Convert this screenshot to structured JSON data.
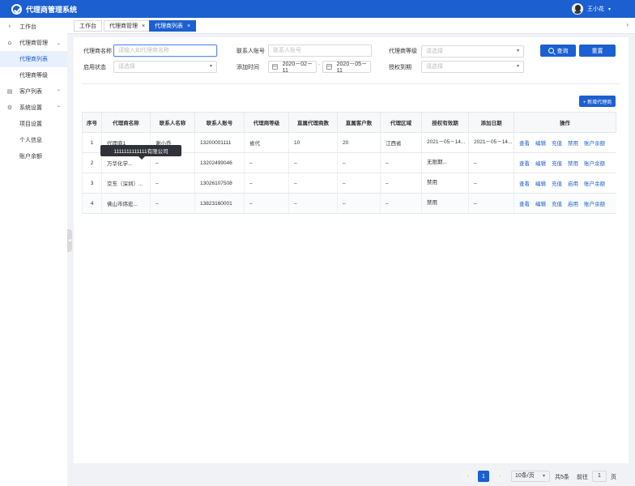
{
  "app": {
    "title": "代理商管理系统",
    "user": "王小花"
  },
  "sidebar": {
    "items": [
      {
        "label": "工作台",
        "icon": "dashboard-icon"
      },
      {
        "label": "代理商管理",
        "icon": "person-icon",
        "expanded": true,
        "children": [
          {
            "label": "代理商列表",
            "active": true
          },
          {
            "label": "代理商等级"
          }
        ]
      },
      {
        "label": "客户列表",
        "icon": "document-icon",
        "expanded": false
      },
      {
        "label": "系统设置",
        "icon": "gear-icon",
        "expanded": true,
        "children": [
          {
            "label": "项目设置"
          },
          {
            "label": "个人信息"
          },
          {
            "label": "账户余额"
          }
        ]
      }
    ]
  },
  "tabs": [
    {
      "label": "工作台",
      "closable": false
    },
    {
      "label": "代理商管理",
      "closable": true
    },
    {
      "label": "代理商列表",
      "closable": true,
      "active": true
    }
  ],
  "filters": {
    "agent_name": {
      "label": "代理商名称",
      "placeholder": "请输入如代理商名称"
    },
    "contact_account": {
      "label": "联系人账号",
      "placeholder": "联系人账号"
    },
    "agent_level": {
      "label": "代理商等级",
      "placeholder": "请选择"
    },
    "status": {
      "label": "启用状态",
      "placeholder": "请选择"
    },
    "add_time": {
      "label": "添加时间",
      "start": "2020－02－11",
      "end": "2020－05－11",
      "separator": "-"
    },
    "auth_expiry": {
      "label": "授权到期",
      "placeholder": "请选择"
    },
    "query_label": "查询",
    "reset_label": "重置"
  },
  "add_agent_label": "+ 新增代理商",
  "table": {
    "columns": [
      "序号",
      "代理商名称",
      "联系人名称",
      "联系人账号",
      "代理商等级",
      "直属代理商数",
      "直属客户数",
      "代理区域",
      "授权有效期",
      "添加日期",
      "操作"
    ],
    "rows": [
      {
        "index": "1",
        "name": "代理商1",
        "contact": "谢小乔",
        "account": "13200001111",
        "level": "省代",
        "sub_agents": "10",
        "customers": "20",
        "region": "江西省",
        "validity": "2021－05－14...",
        "added": "2021－05－14...",
        "actions": [
          "查看",
          "编辑",
          "充值",
          "禁用",
          "账户余额"
        ]
      },
      {
        "index": "2",
        "name": "万华化学...",
        "contact": "–",
        "account": "13202499046",
        "level": "–",
        "sub_agents": "–",
        "customers": "–",
        "region": "–",
        "validity": "无限期...",
        "added": "–",
        "actions": [
          "查看",
          "编辑",
          "充值",
          "禁用",
          "账户余额"
        ]
      },
      {
        "index": "3",
        "name": "京东（深圳）...",
        "contact": "–",
        "account": "13026107508",
        "level": "–",
        "sub_agents": "–",
        "customers": "–",
        "region": "–",
        "validity": "禁用",
        "added": "–",
        "actions": [
          "查看",
          "编辑",
          "充值",
          "启用",
          "账户余额"
        ]
      },
      {
        "index": "4",
        "name": "佛山市炜宏...",
        "contact": "–",
        "account": "13823160001",
        "level": "–",
        "sub_agents": "–",
        "customers": "–",
        "region": "–",
        "validity": "禁用",
        "added": "–",
        "actions": [
          "查看",
          "编辑",
          "充值",
          "启用",
          "账户余额"
        ]
      }
    ]
  },
  "tooltip": "1111111111111有限公司",
  "pagination": {
    "prev": "‹",
    "current": "1",
    "next": "›",
    "page_size": "10条/页",
    "total": "共5条",
    "goto_label": "前往",
    "goto_value": "1",
    "page_unit": "页"
  }
}
